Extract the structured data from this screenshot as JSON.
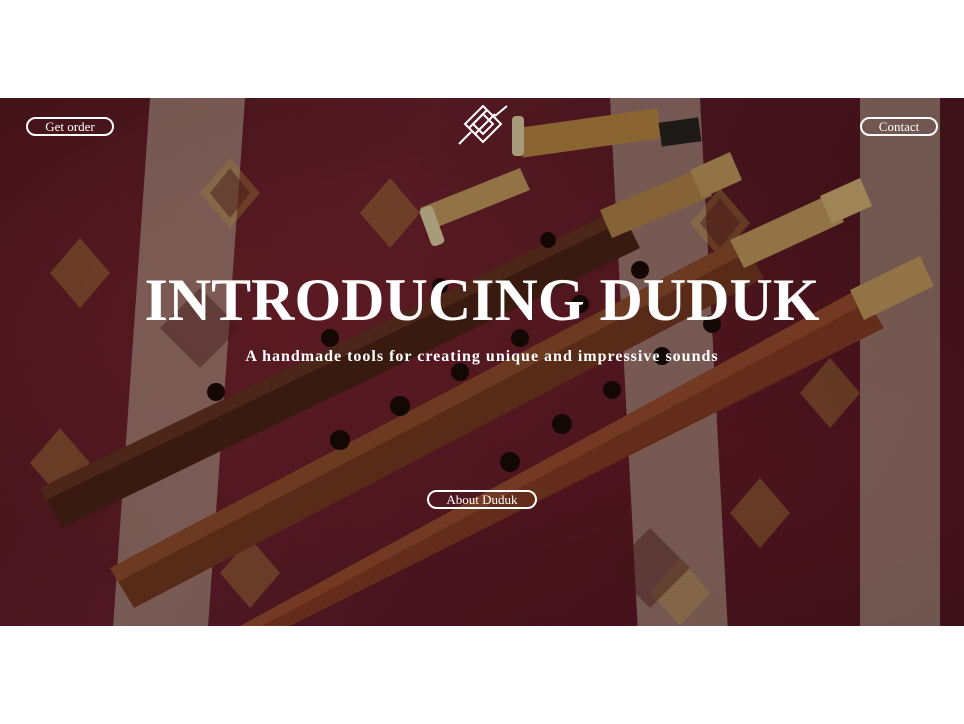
{
  "nav": {
    "order_label": "Get order",
    "contact_label": "Contact"
  },
  "hero": {
    "title": "INTRODUCING DUDUK",
    "subtitle": "A handmade tools for creating unique and impressive sounds",
    "cta_label": "About Duduk",
    "logo_icon": "duduk-logo-icon",
    "background_image": "duduk-instruments-on-carpet-photo"
  },
  "colors": {
    "text": "#ffffff",
    "carpet_red": "#7a1f2e",
    "wood_brown": "#7b3b22",
    "reed_tan": "#c9a060"
  }
}
